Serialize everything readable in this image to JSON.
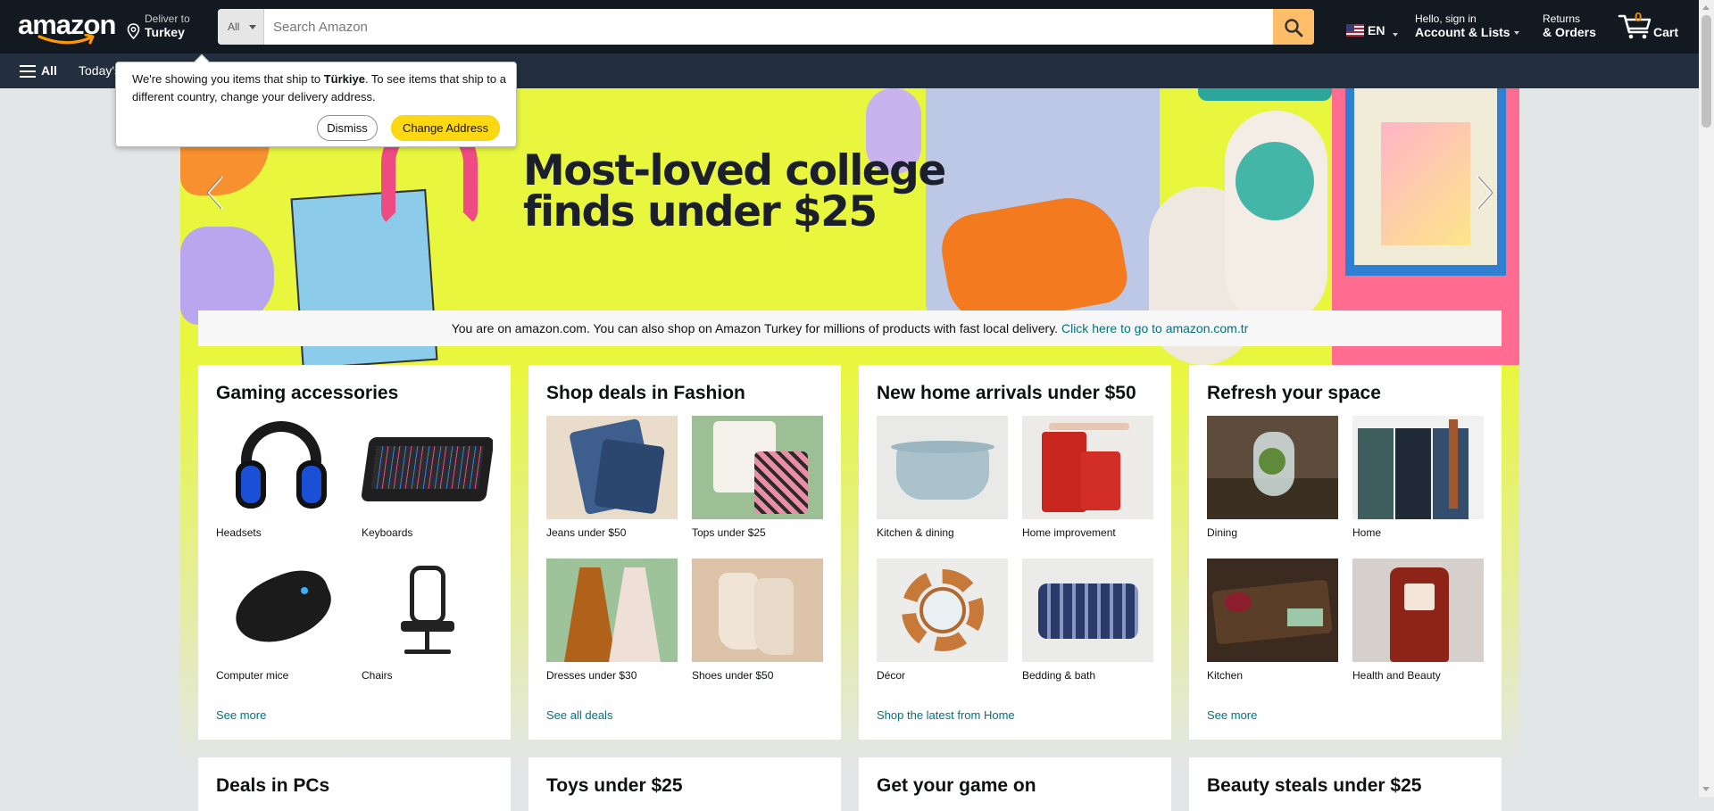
{
  "header": {
    "logo_text": "amazon",
    "deliver_label": "Deliver to",
    "deliver_location": "Turkey",
    "search": {
      "category": "All",
      "placeholder": "Search Amazon"
    },
    "language": "EN",
    "account_greeting": "Hello, sign in",
    "account_label": "Account & Lists",
    "returns_label": "Returns",
    "orders_label": "& Orders",
    "cart_count": "0",
    "cart_label": "Cart"
  },
  "subnav": {
    "all_label": "All",
    "todays_deals": "Today's"
  },
  "popover": {
    "msg_prefix": "We're showing you items that ship to ",
    "msg_country": "Türkiye",
    "msg_suffix": ". To see items that ship to a different country, change your delivery address.",
    "dismiss_label": "Dismiss",
    "change_label": "Change Address"
  },
  "hero": {
    "title_line1": "Most-loved college",
    "title_line2": "finds under $25"
  },
  "shipbar": {
    "text": "You are on amazon.com. You can also shop on Amazon Turkey for millions of products with fast local delivery. ",
    "link": "Click here to go to amazon.com.tr"
  },
  "cards": [
    {
      "title": "Gaming accessories",
      "tiles": [
        "Headsets",
        "Keyboards",
        "Computer mice",
        "Chairs"
      ],
      "link": "See more"
    },
    {
      "title": "Shop deals in Fashion",
      "tiles": [
        "Jeans under $50",
        "Tops under $25",
        "Dresses under $30",
        "Shoes under $50"
      ],
      "link": "See all deals"
    },
    {
      "title": "New home arrivals under $50",
      "tiles": [
        "Kitchen & dining",
        "Home improvement",
        "Décor",
        "Bedding & bath"
      ],
      "link": "Shop the latest from Home"
    },
    {
      "title": "Refresh your space",
      "tiles": [
        "Dining",
        "Home",
        "Kitchen",
        "Health and Beauty"
      ],
      "link": "See more"
    }
  ],
  "cards_row2": [
    "Deals in PCs",
    "Toys under $25",
    "Get your game on",
    "Beauty steals under $25"
  ],
  "colors": {
    "nav_dark": "#131921",
    "nav_sub": "#232f3e",
    "search_button": "#febd69",
    "cart_count": "#f08804",
    "link": "#007185",
    "hero_bg": "#e8f73d",
    "primary_button": "#ffd814"
  },
  "icons": [
    "location-pin-icon",
    "search-icon",
    "us-flag-icon",
    "cart-icon",
    "hamburger-icon",
    "chevron-left-icon",
    "chevron-right-icon"
  ]
}
